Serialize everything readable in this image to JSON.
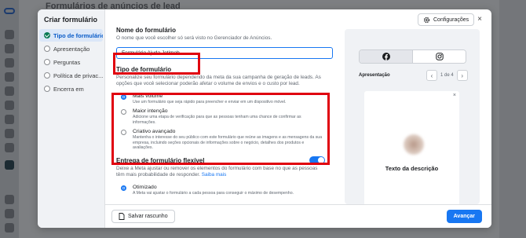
{
  "background": {
    "page_title": "Formulários de anúncios de lead"
  },
  "modal": {
    "sidebar": {
      "title": "Criar formulário",
      "items": [
        {
          "label": "Tipo de formulário",
          "state": "done",
          "active": true
        },
        {
          "label": "Apresentação",
          "state": "pending"
        },
        {
          "label": "Perguntas",
          "state": "pending"
        },
        {
          "label": "Política de privac...",
          "state": "pending"
        },
        {
          "label": "Encerra em",
          "state": "pending"
        }
      ]
    },
    "form_name": {
      "title": "Nome do formulário",
      "description": "O nome que você escolher só será visto no Gerenciador de Anúncios.",
      "value": "Formulário Ajuda Jetimob"
    },
    "form_type": {
      "title": "Tipo de formulário",
      "description": "Personalize seu formulário dependendo da meta da sua campanha de geração de leads. As opções que você selecionar poderão afetar o volume de envios e o custo por lead.",
      "options": [
        {
          "title": "Mais volume",
          "desc": "Use um formulário que seja rápido para preencher e enviar em um dispositivo móvel.",
          "selected": true
        },
        {
          "title": "Maior intenção",
          "desc": "Adicione uma etapa de verificação para que as pessoas tenham uma chance de confirmar as informações.",
          "selected": false
        },
        {
          "title": "Criativo avançado",
          "desc": "Mantenha o interesse do seu público com este formulário que reúne as imagens e as mensagens da sua empresa, incluindo seções opcionais de informações sobre o negócio, detalhes dos produtos e avaliações.",
          "selected": false
        }
      ]
    },
    "flexible": {
      "title": "Entrega de formulário flexível",
      "description": "Deixe a Meta ajustar ou remover os elementos do formulário com base no que as pessoas têm mais probabilidade de responder.",
      "link": "Saiba mais",
      "toggle_on": true,
      "option_title": "Otimizado",
      "option_desc": "A Meta vai ajustar o formulário a cada pessoa para conseguir o máximo de desempenho."
    },
    "footer": {
      "save_draft": "Salvar rascunho",
      "next": "Avançar"
    },
    "preview": {
      "config_button": "Configurações",
      "close": "×",
      "platforms": [
        "facebook-icon",
        "instagram-icon"
      ],
      "section_label": "Apresentação",
      "pager": "1 de 4",
      "card_close": "×",
      "card_text": "Texto da descrição"
    }
  },
  "colors": {
    "accent": "#1877f2",
    "highlight": "#e0010f",
    "success": "#0a7b55"
  }
}
